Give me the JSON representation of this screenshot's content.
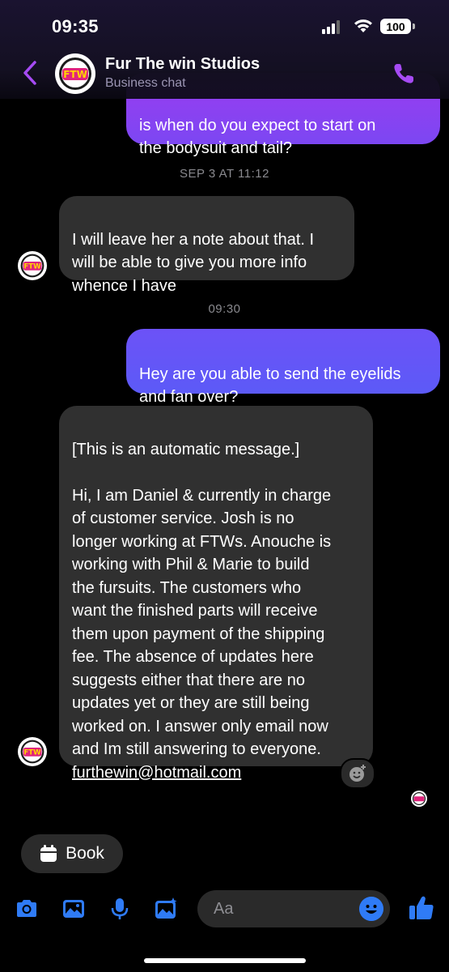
{
  "status_bar": {
    "time": "09:35",
    "battery": "100"
  },
  "header": {
    "title": "Fur The win Studios",
    "subtitle": "Business chat",
    "avatar_text": "FTW"
  },
  "messages": {
    "m1": "is when do you expect to start on\nthe bodysuit and tail?",
    "ts1": "SEP 3 AT 11:12",
    "m2": "I will leave her a note about that. I\nwill be able to give you more info\nwhence I have",
    "ts2": "09:30",
    "m3": "Hey are you able to send the eyelids\nand fan over?",
    "m4_text": "[This is an automatic message.]\n\nHi, I am Daniel & currently in charge\nof customer service. Josh is no\nlonger working at FTWs. Anouche is\nworking with Phil & Marie to build\nthe fursuits. The customers who\nwant the finished parts will receive\nthem upon payment of the shipping\nfee. The absence of updates here\nsuggests either that there are no\nupdates yet or they are still being\nworked on. I answer only email now\nand Im still answering to everyone.\n",
    "m4_email": "furthewin@hotmail.com"
  },
  "book_chip": {
    "label": "Book"
  },
  "composer": {
    "placeholder": "Aa"
  },
  "colors": {
    "accent": "#a64bf4",
    "outgoing_top": "#9b3cf0",
    "outgoing_bottom": "#5c5af7",
    "incoming": "#303030",
    "composer_icon": "#2f7bf6"
  },
  "icons": [
    "back-chevron-icon",
    "phone-icon",
    "camera-icon",
    "photo-icon",
    "microphone-icon",
    "gallery-sparkle-icon",
    "emoji-icon",
    "thumbs-up-icon",
    "calendar-icon",
    "add-reaction-icon"
  ]
}
